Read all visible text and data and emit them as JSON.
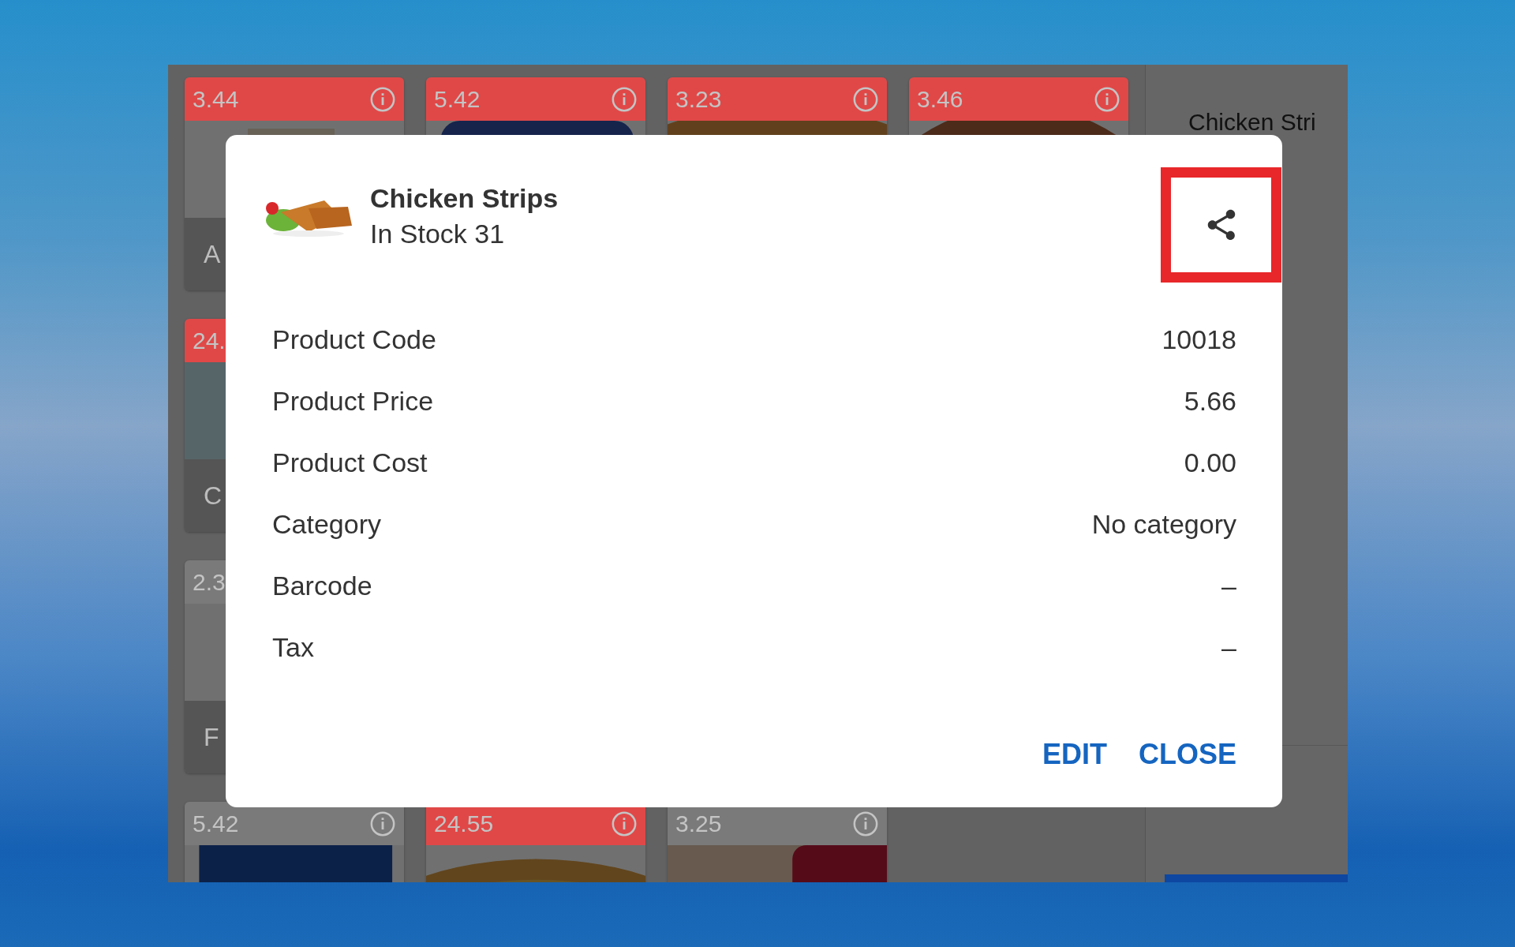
{
  "product_grid": {
    "rows": [
      {
        "tiles": [
          {
            "price": "3.44",
            "color": "#e04848",
            "name": "A"
          },
          {
            "price": "5.42",
            "color": "#e04848"
          },
          {
            "price": "3.23",
            "color": "#e04848"
          },
          {
            "price": "3.46",
            "color": "#e04848"
          }
        ]
      },
      {
        "tiles": [
          {
            "price": "24.",
            "color": "#e04848",
            "name": "C"
          }
        ]
      },
      {
        "tiles": [
          {
            "price": "2.3",
            "color": "#7a7a7a",
            "name": "F"
          }
        ]
      },
      {
        "tiles": [
          {
            "price": "5.42",
            "color": "#7a7a7a"
          },
          {
            "price": "24.55",
            "color": "#e04848"
          },
          {
            "price": "3.25",
            "color": "#7a7a7a"
          }
        ]
      }
    ]
  },
  "side_panel": {
    "title": "Chicken Stri"
  },
  "dialog": {
    "title": "Chicken Strips",
    "subtitle": "In Stock 31",
    "share_highlighted": true,
    "details": [
      {
        "label": "Product Code",
        "value": "10018"
      },
      {
        "label": "Product Price",
        "value": "5.66"
      },
      {
        "label": "Product Cost",
        "value": "0.00"
      },
      {
        "label": "Category",
        "value": "No category"
      },
      {
        "label": "Barcode",
        "value": "–"
      },
      {
        "label": "Tax",
        "value": "–"
      }
    ],
    "buttons": [
      "EDIT",
      "CLOSE"
    ]
  }
}
